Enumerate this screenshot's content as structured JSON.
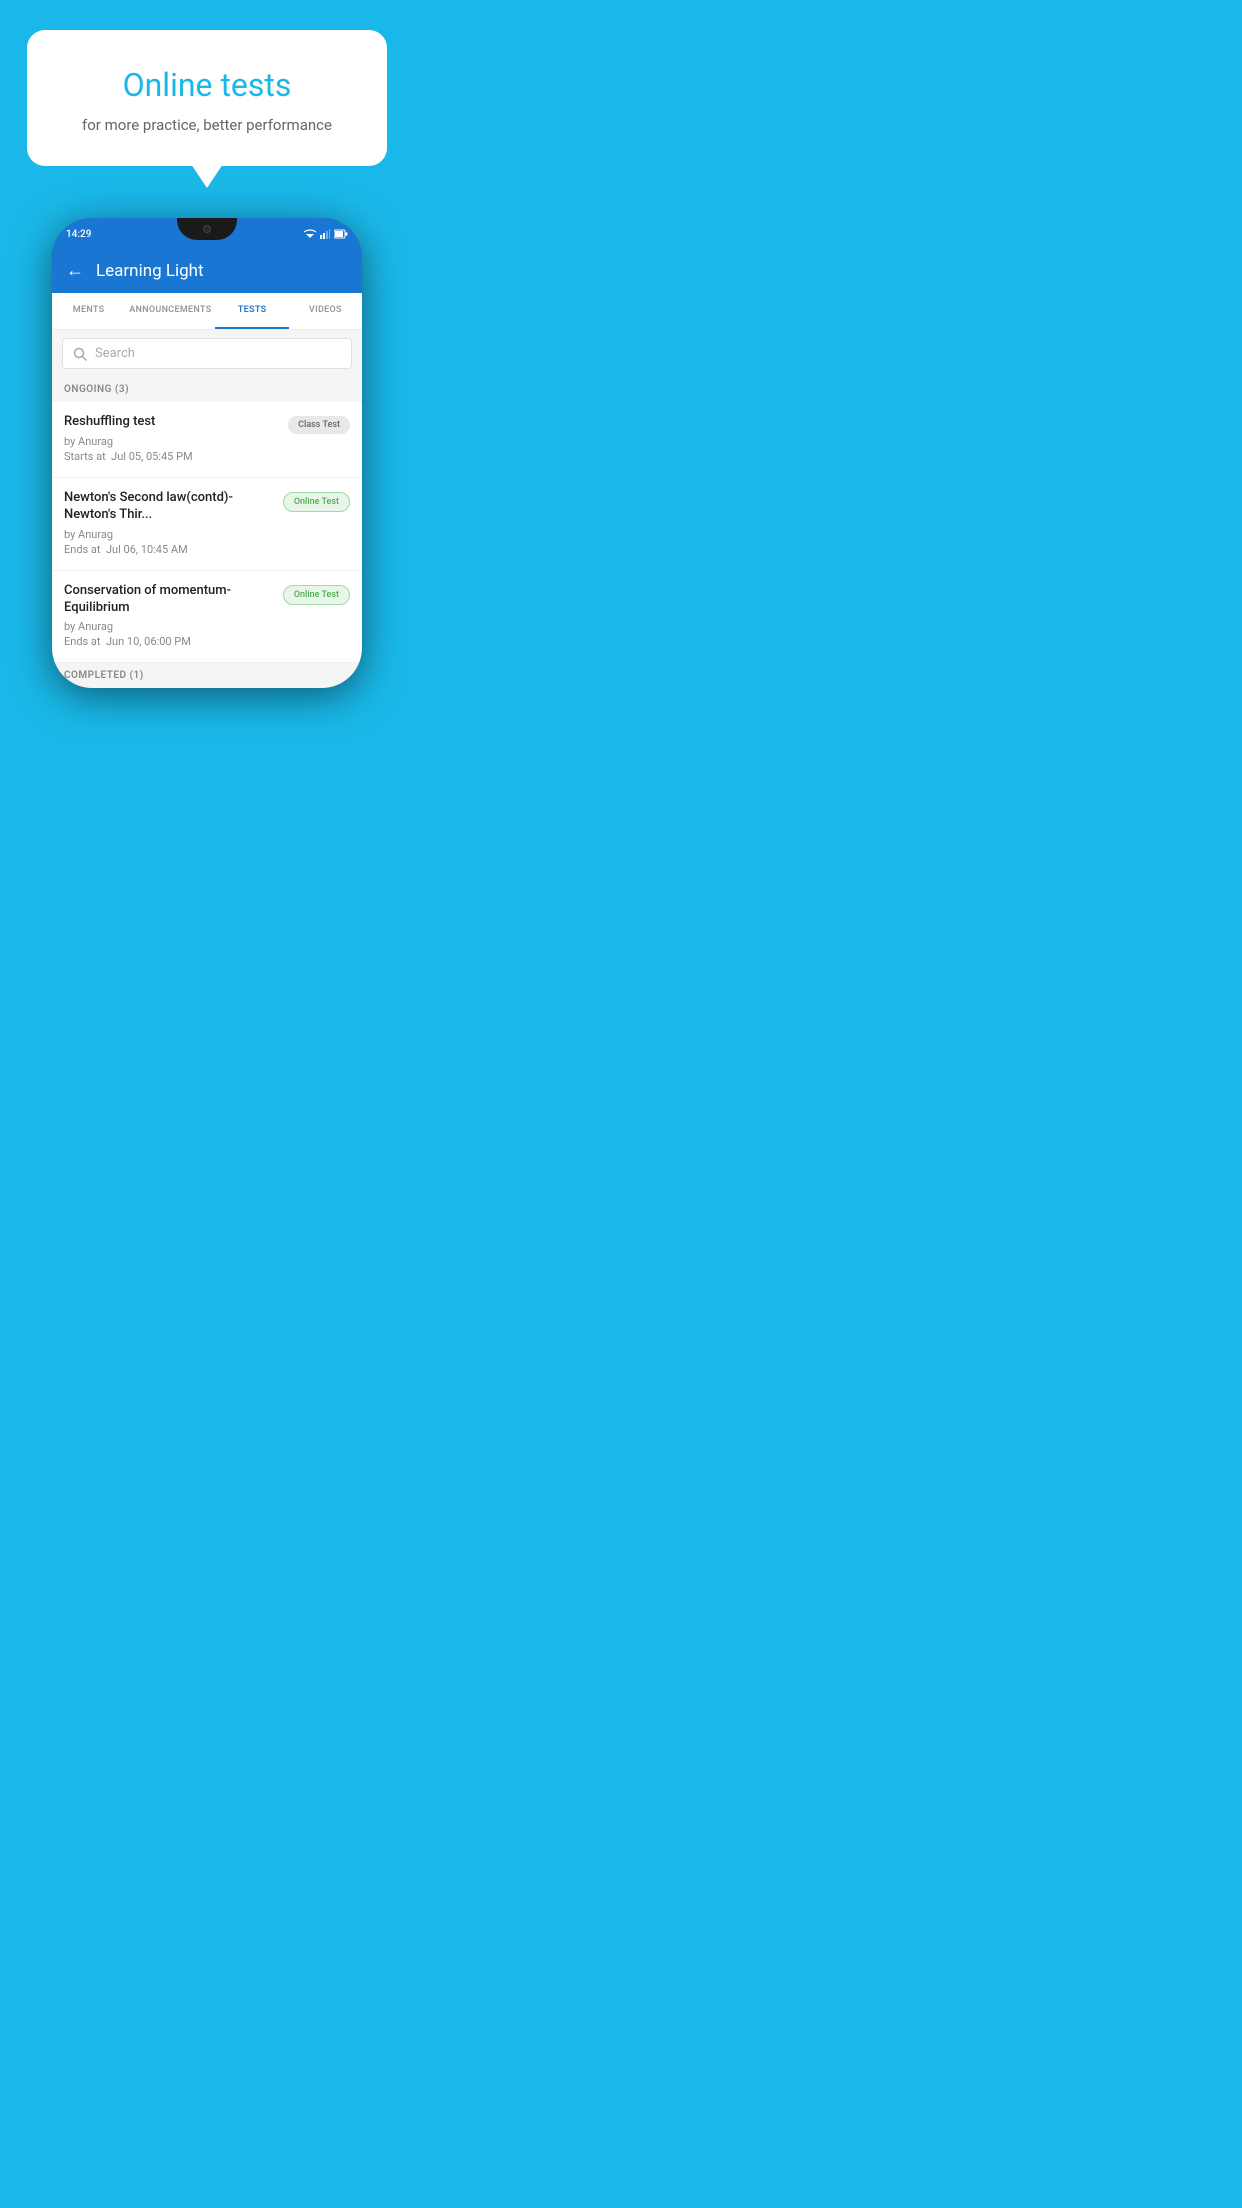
{
  "page": {
    "background_color": "#1ab8e8"
  },
  "bubble": {
    "title": "Online tests",
    "subtitle": "for more practice, better performance"
  },
  "phone": {
    "status_bar": {
      "time": "14:29"
    },
    "header": {
      "title": "Learning Light",
      "back_label": "←"
    },
    "tabs": [
      {
        "label": "MENTS",
        "active": false
      },
      {
        "label": "ANNOUNCEMENTS",
        "active": false
      },
      {
        "label": "TESTS",
        "active": true
      },
      {
        "label": "VIDEOS",
        "active": false
      }
    ],
    "search": {
      "placeholder": "Search"
    },
    "ongoing_section": {
      "label": "ONGOING (3)"
    },
    "tests": [
      {
        "title": "Reshuffling test",
        "by": "by Anurag",
        "date": "Starts at  Jul 05, 05:45 PM",
        "badge": "Class Test",
        "badge_type": "class"
      },
      {
        "title": "Newton's Second law(contd)-Newton's Thir...",
        "by": "by Anurag",
        "date": "Ends at  Jul 06, 10:45 AM",
        "badge": "Online Test",
        "badge_type": "online"
      },
      {
        "title": "Conservation of momentum-Equilibrium",
        "by": "by Anurag",
        "date": "Ends at  Jun 10, 06:00 PM",
        "badge": "Online Test",
        "badge_type": "online"
      }
    ],
    "completed_section": {
      "label": "COMPLETED (1)"
    }
  }
}
